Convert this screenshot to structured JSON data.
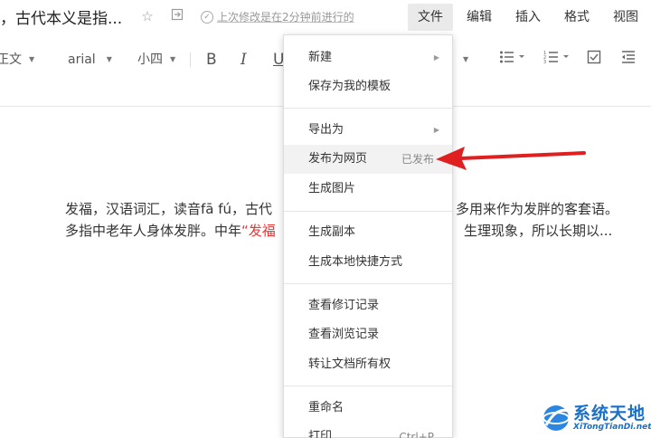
{
  "title_bar": {
    "doc_title": "，古代本义是指...",
    "save_status": "上次修改是在2分钟前进行的"
  },
  "menubar": {
    "items": [
      "文件",
      "编辑",
      "插入",
      "格式",
      "视图"
    ],
    "active": "文件"
  },
  "toolbar": {
    "paragraph_style": "正文",
    "font_family": "arial",
    "font_size": "小四",
    "bold": "B",
    "italic": "I",
    "underline": "U"
  },
  "document": {
    "line1_start": "发福，汉语词汇，读音fā fú，古代",
    "line1_end": "多用来作为发胖的客套语。",
    "line2_start": "多指中老年人身体发胖。中年",
    "line2_red": "“发福",
    "line2_end": "生理现象，所以长期以..."
  },
  "file_menu": {
    "items": [
      {
        "label": "新建",
        "submenu": true
      },
      {
        "label": "保存为我的模板"
      },
      {
        "label": "导出为",
        "submenu": true
      },
      {
        "label": "发布为网页",
        "hint": "已发布"
      },
      {
        "label": "生成图片"
      },
      {
        "label": "生成副本"
      },
      {
        "label": "生成本地快捷方式"
      },
      {
        "label": "查看修订记录"
      },
      {
        "label": "查看浏览记录"
      },
      {
        "label": "转让文档所有权"
      },
      {
        "label": "重命名"
      },
      {
        "label": "打印",
        "hint": "Ctrl+P"
      }
    ]
  },
  "watermark": {
    "name": "系统天地",
    "site": "XiTongTianDi.net"
  },
  "colors": {
    "annotation_arrow": "#e02020",
    "highlight_text": "#e33333",
    "watermark": "#1a6fc9",
    "menu_active_bg": "#eaeaea"
  },
  "icons": [
    "star-icon",
    "folder-move-icon",
    "check-circle-icon",
    "chevron-right-icon",
    "caret-down-icon",
    "bullet-list-icon",
    "numbered-list-icon",
    "checkbox-icon",
    "indent-icon"
  ]
}
